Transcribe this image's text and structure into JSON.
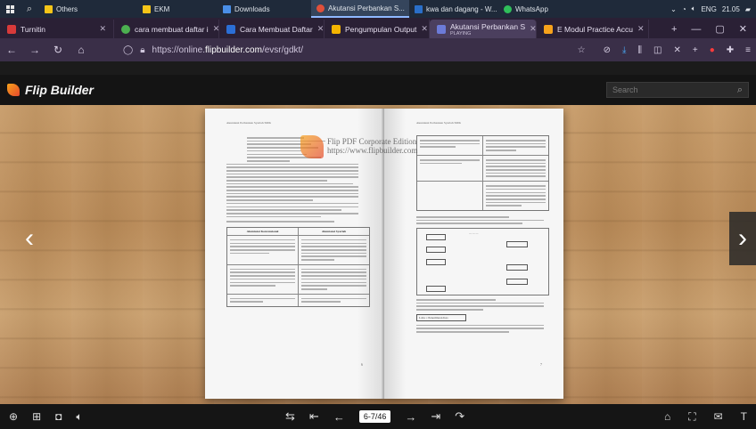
{
  "taskbar": {
    "items": [
      {
        "label": "Others",
        "color": "#f5c518"
      },
      {
        "label": "EKM",
        "color": "#f5c518"
      },
      {
        "label": "Downloads",
        "color": "#4a8fe8"
      },
      {
        "label": "Akutansi Perbankan S...",
        "color": "#e0503a"
      },
      {
        "label": "kwa dan dagang - W...",
        "color": "#2a6fc9"
      },
      {
        "label": "WhatsApp",
        "color": "#2fbf5a"
      }
    ],
    "lang": "ENG",
    "time": "21.05"
  },
  "browser": {
    "tabs": [
      {
        "label": "Turnitin",
        "icon_color": "#d83a3a"
      },
      {
        "label": "cara membuat daftar i",
        "icon_color": "#4caf50"
      },
      {
        "label": "Cara Membuat Daftar",
        "icon_color": "#2b6fd6"
      },
      {
        "label": "Pengumpulan Output",
        "icon_color": "#f4b400"
      },
      {
        "label": "Akutansi Perbankan S",
        "sublabel": "PLAYING",
        "icon_color": "#6c7bd8"
      },
      {
        "label": "E Modul Practice Accu",
        "icon_color": "#f7a21b"
      }
    ],
    "url_prefix": "https://online.",
    "url_host": "flipbuilder.com",
    "url_path": "/evsr/gdkt/"
  },
  "flipbuilder": {
    "logo": "Flip Builder",
    "search_placeholder": "Search"
  },
  "book": {
    "left_header": "Akuntansi Perbankan Syariah SMK",
    "right_header": "Akuntansi Perbankan Syariah SMK",
    "left_table_headers": [
      "Akuntansi Konvensional",
      "Akuntansi Syariah"
    ],
    "left_page_number": "6",
    "right_page_number": "7",
    "right_diagram_button": "Laba = Penerimaan Kas"
  },
  "watermark": {
    "line1": "Flip PDF Corporate Edition",
    "line2": "https://www.flipbuilder.com"
  },
  "toolbar": {
    "page_indicator": "6-7/46"
  }
}
